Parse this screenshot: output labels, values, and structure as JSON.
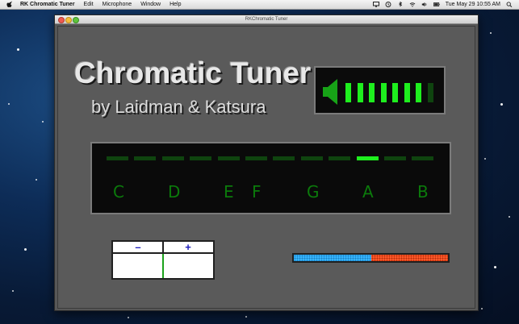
{
  "menubar": {
    "app_name": "RK Chromatic Tuner",
    "items": [
      "Edit",
      "Microphone",
      "Window",
      "Help"
    ],
    "clock": "Tue May 29  10:55 AM"
  },
  "window": {
    "title": "RKChromatic Tuner"
  },
  "tuner": {
    "title": "Chromatic Tuner",
    "subtitle": "by Laidman & Katsura",
    "volume_level_bars": 7,
    "volume_total_bars": 8,
    "notes": [
      "C",
      "D",
      "E",
      "F",
      "G",
      "A",
      "B"
    ],
    "active_segment_index": 9,
    "segment_count": 12,
    "fine_minus_label": "–",
    "fine_plus_label": "+",
    "cents_fraction": 0.5
  },
  "colors": {
    "led_on": "#1eef1e",
    "led_off": "#0f440f",
    "note_text": "#0b7a0b",
    "cents_flat": "#37b6ff",
    "cents_sharp": "#ff5a2a"
  }
}
